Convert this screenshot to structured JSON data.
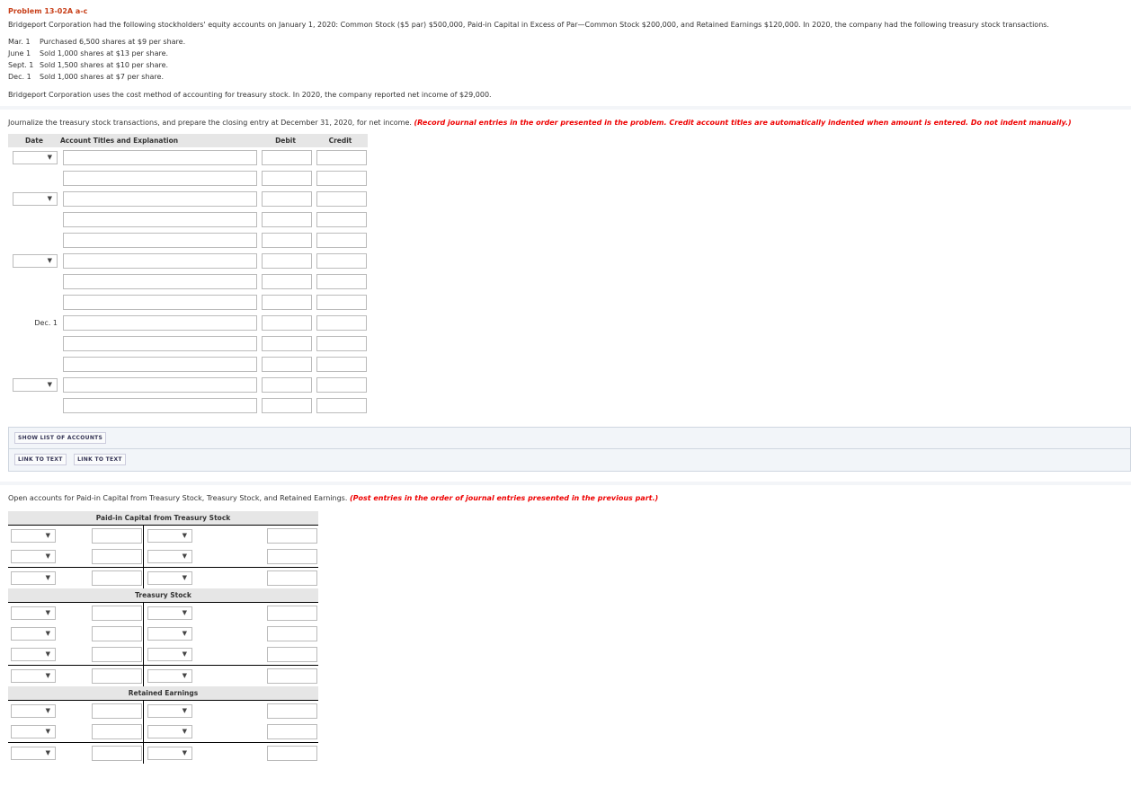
{
  "problem": {
    "title": "Problem 13-02A a-c",
    "intro": "Bridgeport Corporation had the following stockholders' equity accounts on January 1, 2020: Common Stock ($5 par) $500,000, Paid-in Capital in Excess of Par—Common Stock $200,000, and Retained Earnings $120,000. In 2020, the company had the following treasury stock transactions.",
    "transactions": [
      {
        "date": "Mar. 1",
        "text": "Purchased 6,500 shares at $9 per share."
      },
      {
        "date": "June 1",
        "text": "Sold 1,000 shares at $13 per share."
      },
      {
        "date": "Sept. 1",
        "text": "Sold 1,500 shares at $10 per share."
      },
      {
        "date": "Dec. 1",
        "text": "Sold 1,000 shares at $7 per share."
      }
    ],
    "method": "Bridgeport Corporation uses the cost method of accounting for treasury stock. In 2020, the company reported net income of $29,000."
  },
  "journal": {
    "instruction": "Journalize the treasury stock transactions, and prepare the closing entry at December 31, 2020, for net income.",
    "note": "(Record journal entries in the order presented in the problem. Credit account titles are automatically indented when amount is entered. Do not indent manually.)",
    "headers": {
      "date": "Date",
      "account": "Account Titles and Explanation",
      "debit": "Debit",
      "credit": "Credit"
    },
    "rows": [
      "select",
      "",
      "select",
      "",
      "",
      "select",
      "",
      "",
      "Dec. 1",
      "",
      "",
      "select",
      ""
    ]
  },
  "buttons": {
    "show_accounts": "SHOW LIST OF ACCOUNTS",
    "link1": "LINK TO TEXT",
    "link2": "LINK TO TEXT"
  },
  "taccounts": {
    "instruction": "Open accounts for Paid-in Capital from Treasury Stock, Treasury Stock, and Retained Earnings.",
    "note": "(Post entries in the order of journal entries presented in the previous part.)",
    "accounts": [
      {
        "name": "Paid-in Capital from Treasury Stock",
        "rows": 2
      },
      {
        "name": "Treasury Stock",
        "rows": 3
      },
      {
        "name": "Retained Earnings",
        "rows": 2
      }
    ]
  }
}
